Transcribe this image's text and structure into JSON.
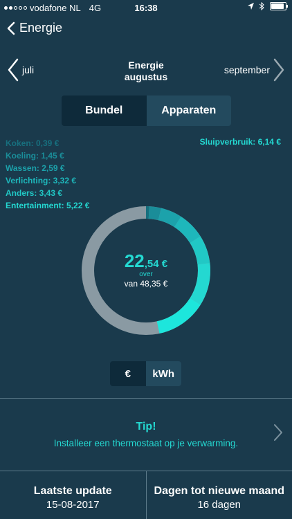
{
  "status": {
    "carrier": "vodafone NL",
    "network": "4G",
    "time": "16:38"
  },
  "nav": {
    "back_label": "Energie"
  },
  "month": {
    "prev": "juli",
    "title": "Energie",
    "subtitle": "augustus",
    "next": "september"
  },
  "segments": {
    "left": "Bundel",
    "right": "Apparaten"
  },
  "legend": [
    {
      "label": "Koken: 0,39 €",
      "color": "#176f7e"
    },
    {
      "label": "Koeling: 1,45 €",
      "color": "#1a8d99"
    },
    {
      "label": "Wassen: 2,59 €",
      "color": "#1ca2ab"
    },
    {
      "label": "Verlichting: 3,32 €",
      "color": "#1eb7bb"
    },
    {
      "label": "Anders: 3,43 €",
      "color": "#21c8c5"
    },
    {
      "label": "Entertainment: 5,22 €",
      "color": "#24d8d1"
    }
  ],
  "sluipverbruik": "Sluipverbruik: 6,14 €",
  "summary": {
    "amount_int": "22",
    "amount_dec": ",54 €",
    "over_label": "over",
    "total_label": "van  48,35 €"
  },
  "donut": {
    "total": 48.35,
    "remaining_color": "#8a9aa3",
    "segments": [
      {
        "value": 0.39,
        "color": "#176f7e"
      },
      {
        "value": 1.45,
        "color": "#1a8d99"
      },
      {
        "value": 2.59,
        "color": "#1ca2ab"
      },
      {
        "value": 3.32,
        "color": "#1eb7bb"
      },
      {
        "value": 3.43,
        "color": "#21c8c5"
      },
      {
        "value": 5.22,
        "color": "#24d8d1"
      },
      {
        "value": 6.14,
        "color": "#1de6dc"
      }
    ]
  },
  "units": {
    "left": "€",
    "right": "kWh"
  },
  "tip": {
    "title": "Tip!",
    "text": "Installeer een thermostaat op je verwarming."
  },
  "footer": {
    "last_update_label": "Laatste update",
    "last_update_value": "15-08-2017",
    "days_label": "Dagen tot nieuwe maand",
    "days_value": "16 dagen"
  }
}
